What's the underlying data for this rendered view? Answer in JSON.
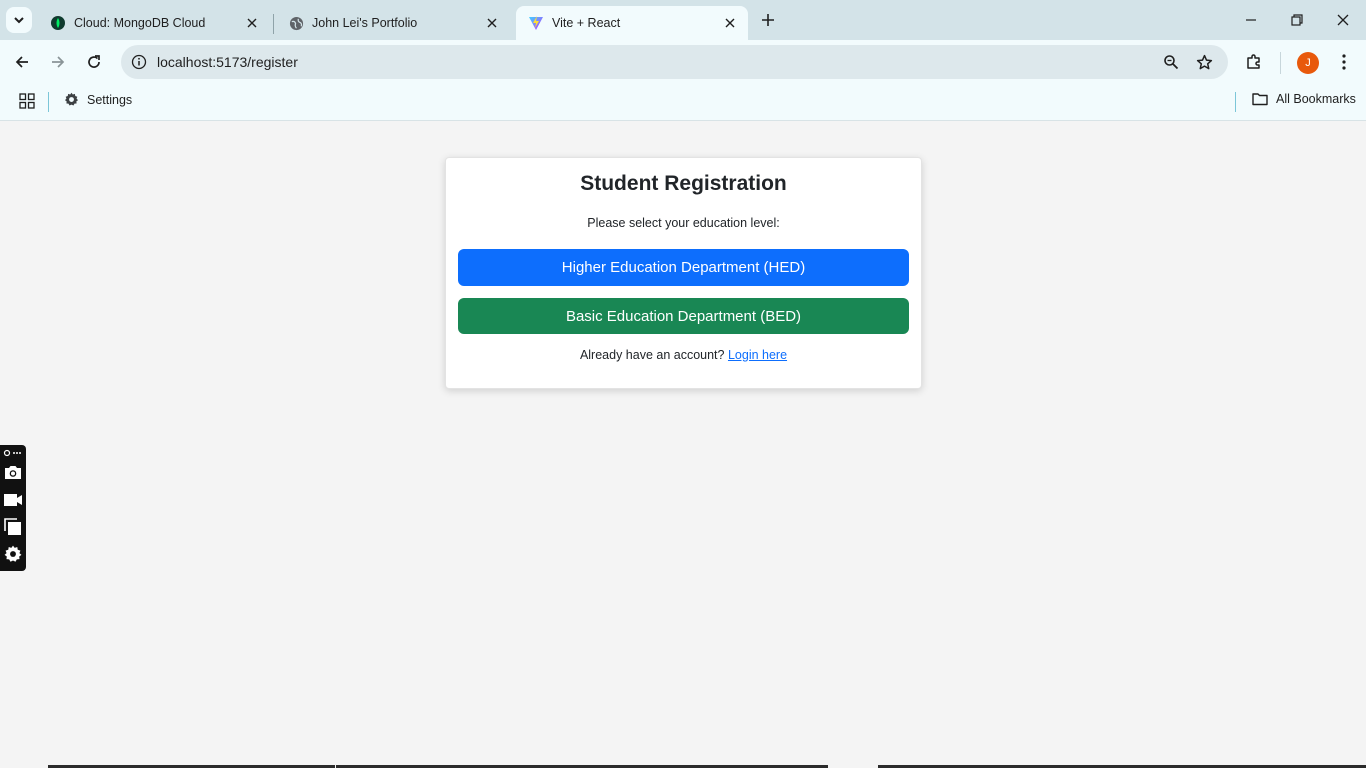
{
  "browser": {
    "tabs": [
      {
        "title": "Cloud: MongoDB Cloud",
        "icon": "mongodb-leaf-icon",
        "active": false
      },
      {
        "title": "John Lei's Portfolio",
        "icon": "globe-icon",
        "active": false
      },
      {
        "title": "Vite + React",
        "icon": "vite-icon",
        "active": true
      }
    ],
    "url": "localhost:5173/register",
    "avatar_letter": "J",
    "bookmarks": {
      "settings_label": "Settings",
      "all_bookmarks_label": "All Bookmarks"
    }
  },
  "page": {
    "title": "Student Registration",
    "subtitle": "Please select your education level:",
    "hed_button": "Higher Education Department (HED)",
    "bed_button": "Basic Education Department (BED)",
    "login_prompt": "Already have an account?",
    "login_link": "Login here"
  },
  "colors": {
    "primary": "#0d6efd",
    "success": "#198754",
    "avatar": "#e8590c"
  }
}
